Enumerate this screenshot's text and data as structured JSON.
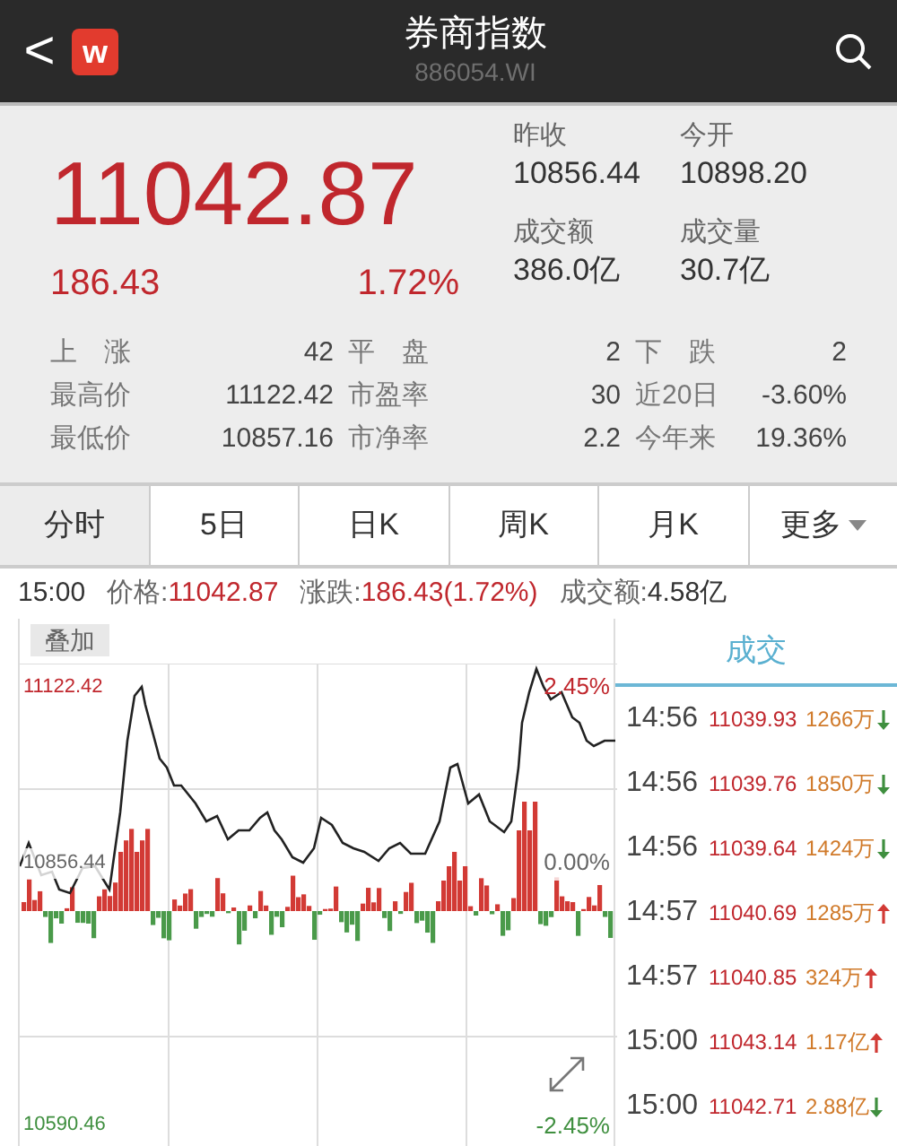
{
  "header": {
    "back": "<",
    "logo": "w",
    "title": "券商指数",
    "code": "886054.WI"
  },
  "quote": {
    "price": "11042.87",
    "change": "186.43",
    "percent": "1.72%",
    "stats": [
      {
        "label": "昨收",
        "value": "10856.44"
      },
      {
        "label": "今开",
        "value": "10898.20"
      },
      {
        "label": "成交额",
        "value": "386.0亿"
      },
      {
        "label": "成交量",
        "value": "30.7亿"
      }
    ]
  },
  "breadth": [
    [
      {
        "label": "上　涨",
        "value": "42"
      },
      {
        "label": "平　盘",
        "value": "2"
      },
      {
        "label": "下　跌",
        "value": "2"
      }
    ],
    [
      {
        "label": "最高价",
        "value": "11122.42"
      },
      {
        "label": "市盈率",
        "value": "30"
      },
      {
        "label": "近20日",
        "value": "-3.60%"
      }
    ],
    [
      {
        "label": "最低价",
        "value": "10857.16"
      },
      {
        "label": "市净率",
        "value": "2.2"
      },
      {
        "label": "今年来",
        "value": "19.36%"
      }
    ]
  ],
  "tabs": [
    {
      "label": "分时",
      "selected": true
    },
    {
      "label": "5日",
      "selected": false
    },
    {
      "label": "日K",
      "selected": false
    },
    {
      "label": "周K",
      "selected": false
    },
    {
      "label": "月K",
      "selected": false
    },
    {
      "label": "更多",
      "selected": false,
      "dropdown": true
    }
  ],
  "info": {
    "time": "15:00",
    "price_label": "价格:",
    "price": "11042.87",
    "change_label": "涨跌:",
    "change": "186.43(1.72%)",
    "volume_label": "成交额:",
    "volume": "4.58亿"
  },
  "chart": {
    "overlay_button": "叠加",
    "high": "11122.42",
    "mid": "10856.44",
    "low": "10590.46",
    "high_pct": "2.45%",
    "mid_pct": "0.00%",
    "low_pct": "-2.45%"
  },
  "trades_title": "成交",
  "trades": [
    {
      "time": "14:56",
      "price": "11039.93",
      "volume": "1266万",
      "up": false
    },
    {
      "time": "14:56",
      "price": "11039.76",
      "volume": "1850万",
      "up": false
    },
    {
      "time": "14:56",
      "price": "11039.64",
      "volume": "1424万",
      "up": false
    },
    {
      "time": "14:57",
      "price": "11040.69",
      "volume": "1285万",
      "up": true
    },
    {
      "time": "14:57",
      "price": "11040.85",
      "volume": "324万",
      "up": true
    },
    {
      "time": "15:00",
      "price": "11043.14",
      "volume": "1.17亿",
      "up": true
    },
    {
      "time": "15:00",
      "price": "11042.71",
      "volume": "2.88亿",
      "up": false
    }
  ]
}
